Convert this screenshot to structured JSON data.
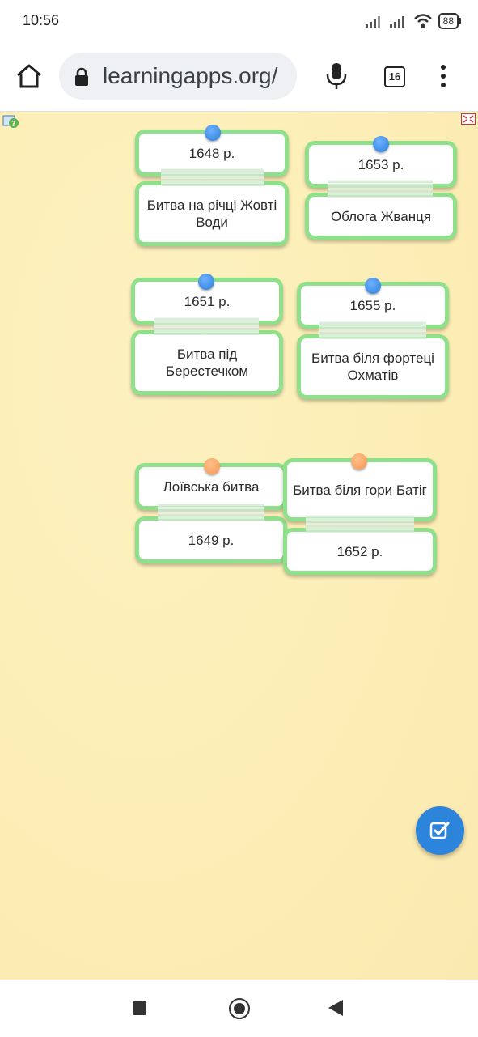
{
  "status_bar": {
    "time": "10:56",
    "battery": "88"
  },
  "browser": {
    "url": "learningapps.org/",
    "tab_count": "16"
  },
  "pairs": [
    {
      "top": "1648 р.",
      "bottom": "Битва на річці Жовті Води",
      "pin": "blue"
    },
    {
      "top": "1653 р.",
      "bottom": "Облога Жванця",
      "pin": "blue"
    },
    {
      "top": "1651 р.",
      "bottom": "Битва під Берестечком",
      "pin": "blue"
    },
    {
      "top": "1655 р.",
      "bottom": "Битва біля фортеці Охматів",
      "pin": "blue"
    },
    {
      "top": "Лоївська битва",
      "bottom": "1649 р.",
      "pin": "orange"
    },
    {
      "top": "Битва біля гори Батіг",
      "bottom": "1652 р.",
      "pin": "orange"
    }
  ],
  "colors": {
    "card_border": "#8fe08b",
    "pin_blue": "#2a7fd8",
    "pin_orange": "#f39652",
    "background": "#fcefb8",
    "check_button": "#2d85db"
  },
  "icons": [
    "home-icon",
    "lock-icon",
    "mic-icon",
    "tabs-icon",
    "menu-icon",
    "help-icon",
    "fullscreen-icon",
    "check-icon"
  ]
}
